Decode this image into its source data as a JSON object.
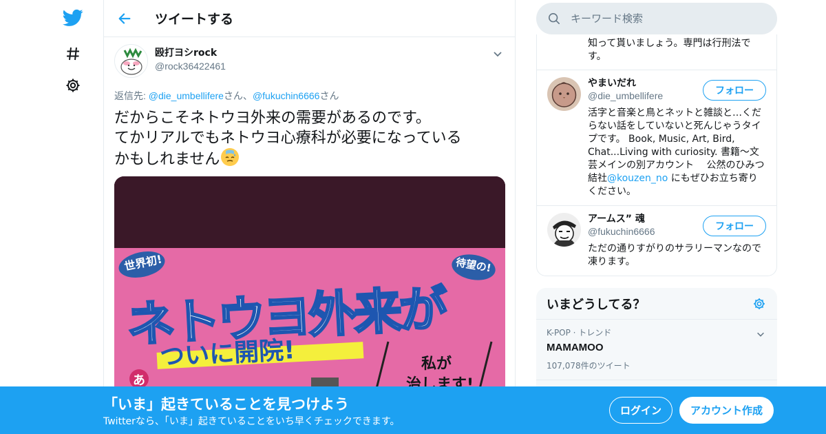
{
  "colors": {
    "brand": "#1da1f2",
    "text": "#14171a",
    "secondary": "#657786",
    "border": "#e6ecf0",
    "media_bg": "#3a1828",
    "media_pink": "#e56aa6"
  },
  "nav": {
    "icons": [
      "twitter-bird-icon",
      "hashtag-icon",
      "gear-icon"
    ]
  },
  "header": {
    "title": "ツイートする",
    "back_icon": "arrow-left-icon"
  },
  "tweet": {
    "author_name": "殴打ヨシrock",
    "author_handle": "@rock36422461",
    "reply_prefix": "返信先: ",
    "reply_user_1": "@die_umbellifere",
    "reply_sep_1": "さん、",
    "reply_user_2": "@fukuchin6666",
    "reply_sep_2": "さん",
    "text": "だからこそネトウヨ外来の需要があるのです。\nてかリアルでもネトウヨ心療科が必要になっている\nかもしれません",
    "emoji": "😓",
    "image": {
      "badge_left": "世界初!",
      "badge_right": "待望の!",
      "headline": "ネトウヨ外来が",
      "subheadline": "ついに開院!",
      "side_text_1": "私が",
      "side_text_2": "治します!",
      "corner_char": "あ"
    }
  },
  "search": {
    "placeholder": "キーワード検索"
  },
  "users": {
    "prev_bio_tail": "知って貰いましょう。専門は行刑法です。",
    "list": [
      {
        "name": "やまいだれ",
        "handle": "@die_umbellifere",
        "follow_label": "フォロー",
        "bio_text": "活字と音楽と鳥とネットと雑談と…くだらない話をしていないと死んじゃうタイプです。 Book, Music, Art, Bird, Chat...Living with curiosity. 書籍～文芸メインの別アカウント　 公然のひみつ結社",
        "bio_link": "@kouzen_no",
        "bio_tail": " にもぜひお立ち寄りください。"
      },
      {
        "name": "アームス” 魂",
        "handle": "@fukuchin6666",
        "follow_label": "フォロー",
        "bio_text": "ただの通りすがりのサラリーマンなので凍ります。"
      }
    ]
  },
  "trends": {
    "title": "いまどうしてる？",
    "items": [
      {
        "meta": "K-POP · トレンド",
        "name": "MAMAMOO",
        "count": "107,078件のツイート"
      }
    ]
  },
  "banner": {
    "title": "「いま」起きていることを見つけよう",
    "subtitle": "Twitterなら、「いま」起きていることをいち早くチェックできます。",
    "login_label": "ログイン",
    "signup_label": "アカウント作成"
  }
}
